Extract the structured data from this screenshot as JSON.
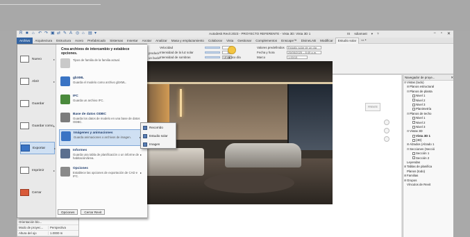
{
  "window": {
    "title": "Autodesk Revit 2023 - PROYECTO REFERENTE - Vista 3D: Vista 3D 1",
    "account": [
      "IS",
      "sdiamast",
      "▾",
      "?"
    ],
    "qat_icons": [
      "R",
      "■",
      "⌂",
      "↶",
      "↷",
      "▣",
      "⇄",
      "✎",
      "A",
      "◎",
      "⌂",
      "▤",
      "▾"
    ],
    "win_controls": [
      "−",
      "▫",
      "✕"
    ]
  },
  "tabs": {
    "file": "Archivo",
    "items": [
      "Arquitectura",
      "Estructura",
      "Acero",
      "Prefabricado",
      "Sistemas",
      "Insertar",
      "Anotar",
      "Analizar",
      "Masa y emplazamiento",
      "Colaborar",
      "Vista",
      "Gestionar",
      "Complementos",
      "Enscape™",
      "DivineLAB",
      "Modificar",
      "Estudio solar",
      "▭ •"
    ]
  },
  "ribbon": {
    "visualize": {
      "rows": [
        {
          "label": "Velocidad",
          "value": "5"
        },
        {
          "label": "Intensidad de la luz solar",
          "value": "50"
        },
        {
          "label": "Intensidad de sombras",
          "value": "50"
        }
      ],
      "title": "Visualizar"
    },
    "study": {
      "label": "Un único día",
      "title": "Tipo de estudio"
    },
    "defaults": {
      "rows": [
        {
          "label": "Valores predefinidos",
          "value": "Estudio solar de un día"
        },
        {
          "label": "Fecha y hora",
          "value": "25/05/2025 – 8:49 a.m."
        },
        {
          "label": "Marco",
          "value": "1.00/15"
        }
      ],
      "title": "Valores predefinidos y datos"
    },
    "left_items": [
      "producir",
      "un bucle"
    ]
  },
  "file_menu": {
    "commands": [
      {
        "label": "Nuevo",
        "arrow": "▸"
      },
      {
        "label": "Abrir",
        "arrow": "▸"
      },
      {
        "label": "Guardar",
        "arrow": ""
      },
      {
        "label": "Guardar como",
        "arrow": "▸"
      },
      {
        "label": "Exportar",
        "arrow": "▸"
      },
      {
        "label": "Imprimir",
        "arrow": "▸"
      },
      {
        "label": "Cerrar",
        "arrow": ""
      }
    ],
    "header": "Crea archivos de intercambio y establece opciones.",
    "items": [
      {
        "title": "",
        "desc": "Tipos de familia de la familia actual."
      },
      {
        "title": "gbXML",
        "desc": "Guarda el modelo como archivo gbXML."
      },
      {
        "title": "IFC",
        "desc": "Guarda un archivo IFC."
      },
      {
        "title": "Base de datos ODBC",
        "desc": "Guarda los datos de modelo en una base de datos ODBC."
      },
      {
        "title": "Imágenes y animaciones",
        "desc": "Guarda animaciones o archivos de imagen."
      },
      {
        "title": "Informes",
        "desc": "Guarda una tabla de planificación o un informe de habitación/área."
      },
      {
        "title": "Opciones",
        "desc": "Establece las opciones de exportación de CAD e IFC."
      }
    ],
    "buttons": [
      "Opciones",
      "Cerrar Revit"
    ]
  },
  "submenu": {
    "items": [
      "Recorrido",
      "Estudio solar",
      "Imagen"
    ]
  },
  "properties": {
    "head": "Cámara",
    "rows": [
      {
        "k": "Configuración d...",
        "v": "Editar..."
      },
      {
        "k": "Orientación blo...",
        "v": ""
      },
      {
        "k": "Modo de proyec...",
        "v": "Perspectiva"
      },
      {
        "k": "Altura del ojo",
        "v": "1.0000 m"
      },
      {
        "k": "Altura de destino",
        "v": "1.0000 m"
      },
      {
        "k": "Posición de cám...",
        "v": "Explícito"
      }
    ],
    "top_label": "Caja de sección"
  },
  "browser": {
    "title": "Navegador de proye...",
    "nodes": [
      {
        "label": "Vistas (todo)",
        "indent": 0,
        "tw": "⊟",
        "bold": false
      },
      {
        "label": "Planos estructural",
        "indent": 1,
        "tw": "⊞",
        "bold": false
      },
      {
        "label": "Planos de planta",
        "indent": 1,
        "tw": "⊟",
        "bold": false
      },
      {
        "label": "Nivel 1",
        "indent": 2,
        "tw": "",
        "bold": false
      },
      {
        "label": "Nivel 2",
        "indent": 2,
        "tw": "",
        "bold": false
      },
      {
        "label": "Nivel 3",
        "indent": 2,
        "tw": "",
        "bold": false
      },
      {
        "label": "Planimetría",
        "indent": 2,
        "tw": "",
        "bold": false
      },
      {
        "label": "Planos de techo",
        "indent": 1,
        "tw": "⊟",
        "bold": false
      },
      {
        "label": "Nivel 1",
        "indent": 2,
        "tw": "",
        "bold": false
      },
      {
        "label": "Nivel 2",
        "indent": 2,
        "tw": "",
        "bold": false
      },
      {
        "label": "Nivel 3",
        "indent": 2,
        "tw": "",
        "bold": false
      },
      {
        "label": "Vistas 3D",
        "indent": 1,
        "tw": "⊟",
        "bold": false
      },
      {
        "label": "Vista 3D 1",
        "indent": 2,
        "tw": "",
        "bold": true
      },
      {
        "label": "{3D}",
        "indent": 2,
        "tw": "",
        "bold": false
      },
      {
        "label": "Alzados (Alzado 1",
        "indent": 1,
        "tw": "⊞",
        "bold": false
      },
      {
        "label": "Secciones (Secció",
        "indent": 1,
        "tw": "⊟",
        "bold": false
      },
      {
        "label": "Sección 1",
        "indent": 2,
        "tw": "",
        "bold": false
      },
      {
        "label": "Sección 2",
        "indent": 2,
        "tw": "",
        "bold": false
      },
      {
        "label": "Leyendas",
        "indent": 0,
        "tw": "",
        "bold": false
      },
      {
        "label": "Tablas de planifica",
        "indent": 0,
        "tw": "⊞",
        "bold": false
      },
      {
        "label": "Planos (todo)",
        "indent": 0,
        "tw": "",
        "bold": false
      },
      {
        "label": "Familias",
        "indent": 0,
        "tw": "⊞",
        "bold": false
      },
      {
        "label": "Grupos",
        "indent": 0,
        "tw": "⊞",
        "bold": false
      },
      {
        "label": "Vínculos de Revit",
        "indent": 0,
        "tw": "",
        "bold": false
      }
    ]
  },
  "viewcube_label": "FRENTE"
}
